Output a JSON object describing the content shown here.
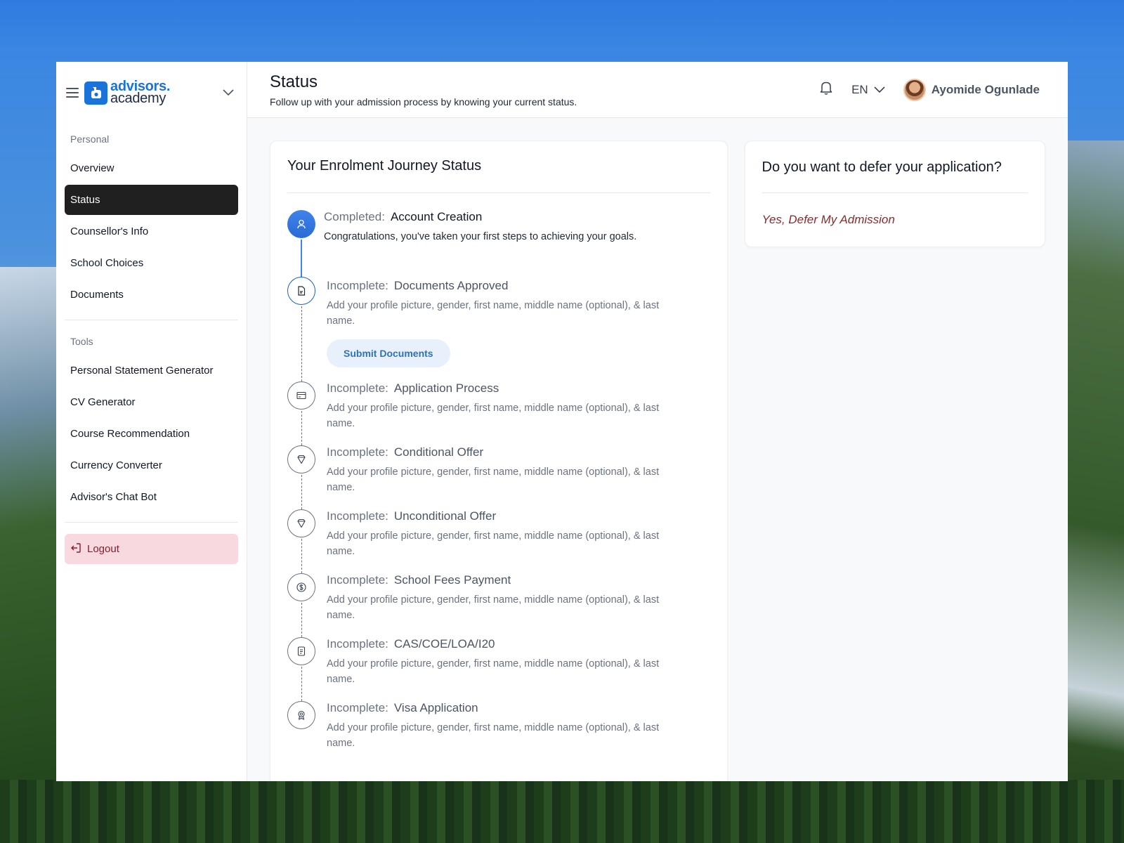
{
  "brand": {
    "line1": "advisors.",
    "line2": "academy"
  },
  "sidebar": {
    "personal_label": "Personal",
    "personal_items": [
      {
        "label": "Overview"
      },
      {
        "label": "Status",
        "active": true
      },
      {
        "label": "Counsellor's Info"
      },
      {
        "label": "School Choices"
      },
      {
        "label": "Documents"
      }
    ],
    "tools_label": "Tools",
    "tools_items": [
      {
        "label": "Personal Statement Generator"
      },
      {
        "label": "CV Generator"
      },
      {
        "label": "Course Recommendation"
      },
      {
        "label": "Currency Converter"
      },
      {
        "label": "Advisor's Chat Bot"
      }
    ],
    "logout_label": "Logout"
  },
  "header": {
    "title": "Status",
    "subtitle": "Follow up with your admission process by knowing your current status.",
    "language": "EN",
    "user_name": "Ayomide Ogunlade"
  },
  "journey": {
    "title": "Your Enrolment Journey Status",
    "steps": [
      {
        "state": "Completed:",
        "name": "Account Creation",
        "desc": "Congratulations, you've taken your first steps to achieving your goals.",
        "icon": "user-icon"
      },
      {
        "state": "Incomplete:",
        "name": "Documents Approved",
        "desc": "Add your profile picture, gender, first name, middle name (optional), & last name.",
        "icon": "document-icon",
        "action": "Submit Documents"
      },
      {
        "state": "Incomplete:",
        "name": "Application Process",
        "desc": "Add your profile picture, gender, first name, middle name (optional), & last name.",
        "icon": "card-icon"
      },
      {
        "state": "Incomplete:",
        "name": "Conditional Offer",
        "desc": "Add your profile picture, gender, first name, middle name (optional), & last name.",
        "icon": "diamond-icon"
      },
      {
        "state": "Incomplete:",
        "name": "Unconditional Offer",
        "desc": "Add your profile picture, gender, first name, middle name (optional), & last name.",
        "icon": "diamond-icon"
      },
      {
        "state": "Incomplete:",
        "name": "School Fees Payment",
        "desc": "Add your profile picture, gender, first name, middle name (optional), & last name.",
        "icon": "dollar-icon"
      },
      {
        "state": "Incomplete:",
        "name": "CAS/COE/LOA/I20",
        "desc": "Add your profile picture, gender, first name, middle name (optional), & last name.",
        "icon": "file-icon"
      },
      {
        "state": "Incomplete:",
        "name": "Visa Application",
        "desc": "Add your profile picture, gender, first name, middle name (optional), & last name.",
        "icon": "badge-icon"
      }
    ]
  },
  "defer": {
    "title": "Do you want to defer your application?",
    "link": "Yes, Defer My Admission"
  },
  "colors": {
    "accent": "#1a73d9",
    "active_nav": "#202020",
    "logout_bg": "#f8d9e0",
    "logout_text": "#8b1d2c",
    "defer_link": "#8b2b2b"
  }
}
